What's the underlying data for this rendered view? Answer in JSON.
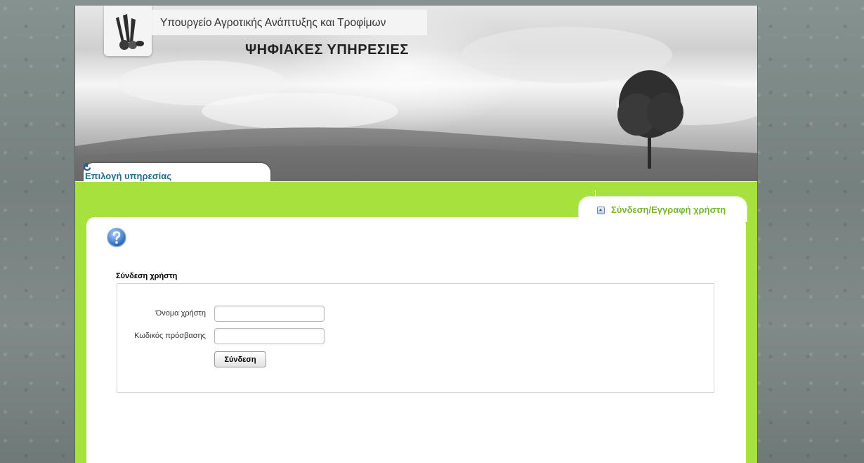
{
  "header": {
    "ministry_title": "Υπουργείο Αγροτικής Ανάπτυξης και Τροφίμων",
    "services_title": "ΨΗΦΙΑΚΕΣ ΥΠΗΡΕΣΙΕΣ",
    "logo_icon": "ministry-emblem-icon"
  },
  "nav": {
    "service_selector_label": "Επιλογή υπηρεσίας",
    "service_selector_icon": "refresh-icon"
  },
  "login_tab": {
    "label": "Σύνδεση/Εγγραφή χρήστη",
    "icon": "collapse-icon"
  },
  "main": {
    "help_icon": "help-icon",
    "section_title": "Σύνδεση χρήστη",
    "form": {
      "username_label": "Όνομα χρήστη",
      "username_value": "",
      "password_label": "Κωδικός πρόσβασης",
      "password_value": "",
      "submit_label": "Σύνδεση"
    }
  },
  "colors": {
    "accent_green": "#a6e13e",
    "tab_text_green": "#77b82a",
    "service_tab_text": "#1f6f8b"
  }
}
